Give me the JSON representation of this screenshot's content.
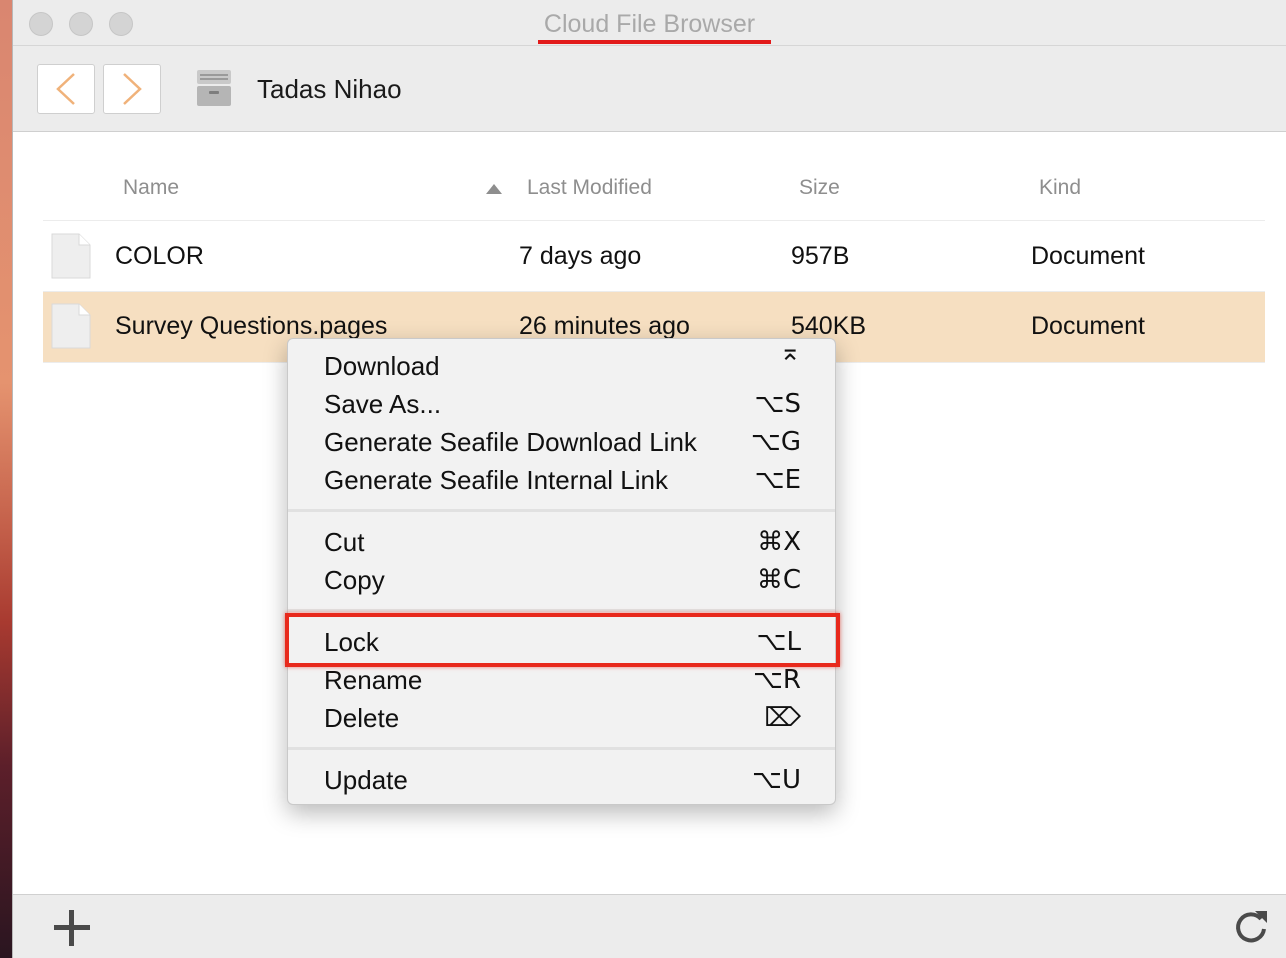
{
  "window": {
    "title": "Cloud File Browser"
  },
  "toolbar": {
    "location": "Tadas Nihao",
    "back_icon": "chevron-left-icon",
    "forward_icon": "chevron-right-icon"
  },
  "columns": {
    "name": "Name",
    "modified": "Last Modified",
    "size": "Size",
    "kind": "Kind"
  },
  "files": [
    {
      "name": "COLOR",
      "modified": "7 days ago",
      "size": "957B",
      "kind": "Document"
    },
    {
      "name": "Survey Questions.pages",
      "modified": "26 minutes ago",
      "size": "540KB",
      "kind": "Document"
    }
  ],
  "context_menu": {
    "items": [
      {
        "label": "Download",
        "shortcut": "⌅"
      },
      {
        "label": "Save As...",
        "shortcut": "⌥S"
      },
      {
        "label": "Generate Seafile Download Link",
        "shortcut": "⌥G"
      },
      {
        "label": "Generate Seafile Internal Link",
        "shortcut": "⌥E"
      },
      {
        "label": "Cut",
        "shortcut": "⌘X"
      },
      {
        "label": "Copy",
        "shortcut": "⌘C"
      },
      {
        "label": "Lock",
        "shortcut": "⌥L"
      },
      {
        "label": "Rename",
        "shortcut": "⌥R"
      },
      {
        "label": "Delete",
        "shortcut": "⌦"
      },
      {
        "label": "Update",
        "shortcut": "⌥U"
      }
    ]
  },
  "colors": {
    "accent": "#f0b27a",
    "selection": "#f6dfc1",
    "annotation": "#e8291c"
  }
}
